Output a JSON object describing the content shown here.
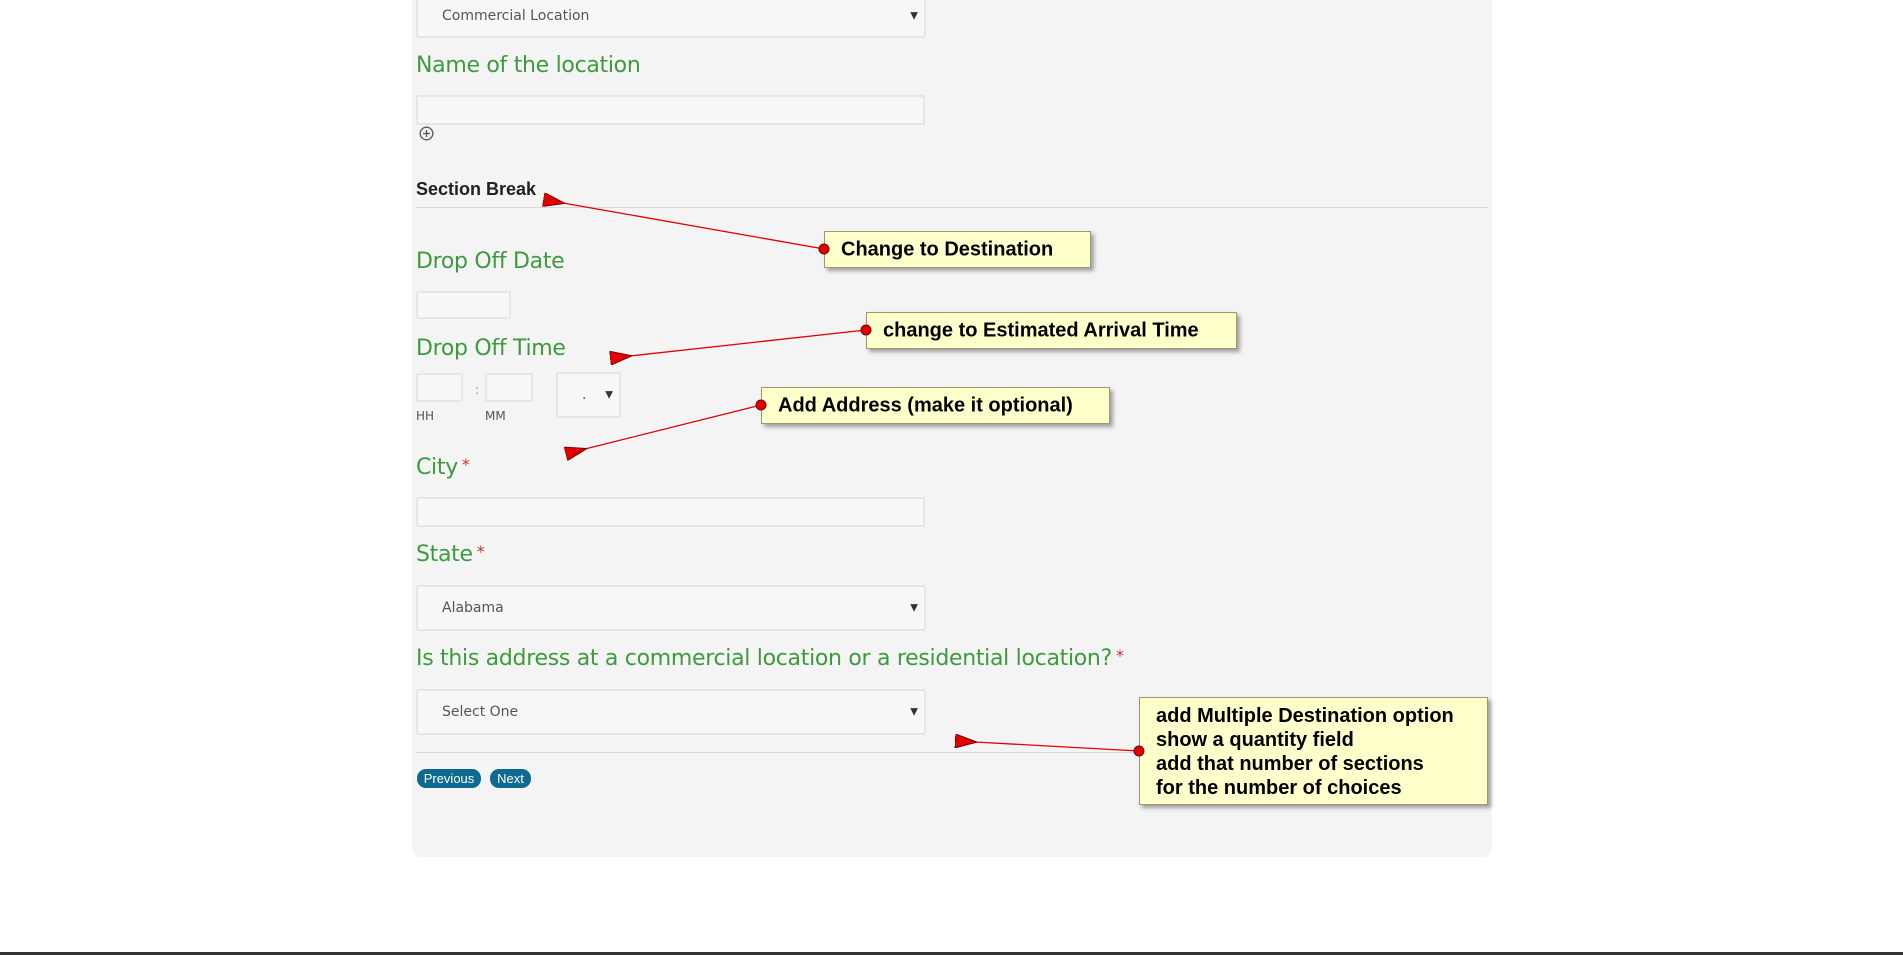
{
  "form": {
    "location_type_select": {
      "value": "Commercial Location"
    },
    "name_label": "Name of the location",
    "add_icon": "plus-circle-icon",
    "section_break": "Section Break",
    "drop_off_date_label": "Drop Off Date",
    "drop_off_time_label": "Drop Off Time",
    "time_separator": ":",
    "hh_label": "HH",
    "mm_label": "MM",
    "ampm_value": ".",
    "city_label": "City",
    "state_label": "State",
    "required_mark": "*",
    "state_select": {
      "value": "Alabama"
    },
    "commercial_question": "Is this address at a commercial location or a residential location?",
    "commercial_select": {
      "value": "Select One"
    },
    "previous_label": "Previous",
    "next_label": "Next"
  },
  "annotations": {
    "note1": "Change to Destination",
    "note2": "change to Estimated Arrival Time",
    "note3": "Add Address (make it optional)",
    "note4_lines": [
      "add Multiple Destination option",
      "show a quantity field",
      "add that number of sections",
      "for the number of choices"
    ]
  },
  "colors": {
    "label_green": "#3e9a3e",
    "button_blue": "#0e6a8f",
    "note_yellow": "#ffffcc",
    "arrow_red": "#e00000"
  }
}
